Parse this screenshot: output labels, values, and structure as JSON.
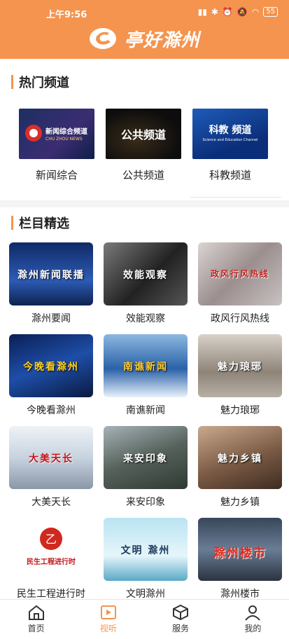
{
  "status_bar": {
    "time": "上午9:56",
    "battery": "55"
  },
  "header": {
    "title": "亭好滁州"
  },
  "hot": {
    "title": "热门频道",
    "items": [
      {
        "label": "新闻综合",
        "thumb_text": "新闻综合频道",
        "thumb_sub": "CHU ZHOU NEWS"
      },
      {
        "label": "公共频道",
        "thumb_text": "公共频道"
      },
      {
        "label": "科教频道",
        "thumb_text": "科教 频道",
        "thumb_sub": "Science and Education Channel"
      }
    ]
  },
  "columns": {
    "title": "栏目精选",
    "items": [
      {
        "label": "滁州要闻",
        "thumb_text": "滁州新闻联播",
        "color": "#1b3f86"
      },
      {
        "label": "效能观察",
        "thumb_text": "效能观察",
        "color": "#3a3a3a"
      },
      {
        "label": "政风行风热线",
        "thumb_text": "政风行风热线",
        "color": "#b8b2b2"
      },
      {
        "label": "今晚看滁州",
        "thumb_text": "今晚看滁州",
        "color": "#12306b"
      },
      {
        "label": "南谯新闻",
        "thumb_text": "南谯新闻",
        "color": "#2f6fb0"
      },
      {
        "label": "魅力琅琊",
        "thumb_text": "魅力琅琊",
        "color": "#a79c90"
      },
      {
        "label": "大美天长",
        "thumb_text": "大美天长",
        "color": "#c8d0da"
      },
      {
        "label": "来安印象",
        "thumb_text": "来安印象",
        "color": "#6d7a6f"
      },
      {
        "label": "魅力乡镇",
        "thumb_text": "魅力乡镇",
        "color": "#8a6e5c"
      },
      {
        "label": "民生工程进行时",
        "thumb_text": "民生工程进行时",
        "color": "#ffffff"
      },
      {
        "label": "文明滁州",
        "thumb_text": "文明 滁州",
        "color": "#a8d6ea"
      },
      {
        "label": "滁州楼市",
        "thumb_text": "滁州楼市",
        "color": "#4b5a6e"
      }
    ]
  },
  "nav": {
    "items": [
      {
        "label": "首页",
        "icon": "home-icon"
      },
      {
        "label": "视听",
        "icon": "play-icon",
        "active": true
      },
      {
        "label": "服务",
        "icon": "cube-icon"
      },
      {
        "label": "我的",
        "icon": "user-icon"
      }
    ]
  },
  "colors": {
    "accent": "#f4944f"
  }
}
